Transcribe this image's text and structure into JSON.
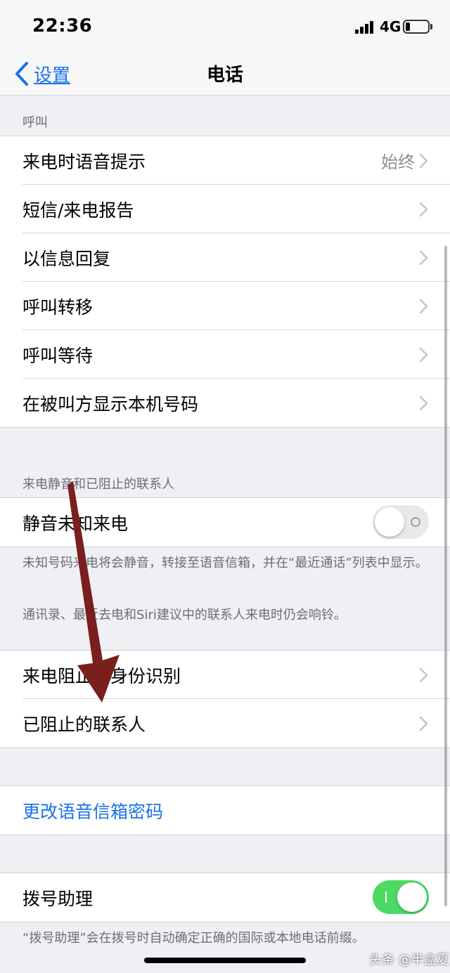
{
  "status_bar": {
    "time": "22:36",
    "network": "4G",
    "icons": [
      "signal-icon",
      "battery-icon"
    ]
  },
  "nav": {
    "back_label": "设置",
    "title": "电话"
  },
  "sections": {
    "calls": {
      "header": "呼叫",
      "rows": [
        {
          "label": "来电时语音提示",
          "value": "始终"
        },
        {
          "label": "短信/来电报告"
        },
        {
          "label": "以信息回复"
        },
        {
          "label": "呼叫转移"
        },
        {
          "label": "呼叫等待"
        },
        {
          "label": "在被叫方显示本机号码"
        }
      ]
    },
    "silence": {
      "header": "来电静音和已阻止的联系人",
      "toggle_row": {
        "label": "静音未知来电",
        "state": "off"
      },
      "footer_1": "未知号码来电将会静音，转接至语音信箱，并在“最近通话”列表中显示。",
      "footer_2": "通讯录、最近去电和Siri建议中的联系人来电时仍会响铃。"
    },
    "blocking": {
      "rows": [
        {
          "label": "来电阻止与身份识别"
        },
        {
          "label": "已阻止的联系人"
        }
      ]
    },
    "voicemail": {
      "link_label": "更改语音信箱密码"
    },
    "dial_assist": {
      "label": "拨号助理",
      "state": "on",
      "footer": "“拨号助理”会在拨号时自动确定正确的国际或本地电话前缀。"
    }
  },
  "watermark": "头条 @半盒夏",
  "colors": {
    "accent": "#1a73e8",
    "toggle_on": "#4cd964",
    "annotation_arrow": "#7a1e1e",
    "background": "#efeff4"
  }
}
